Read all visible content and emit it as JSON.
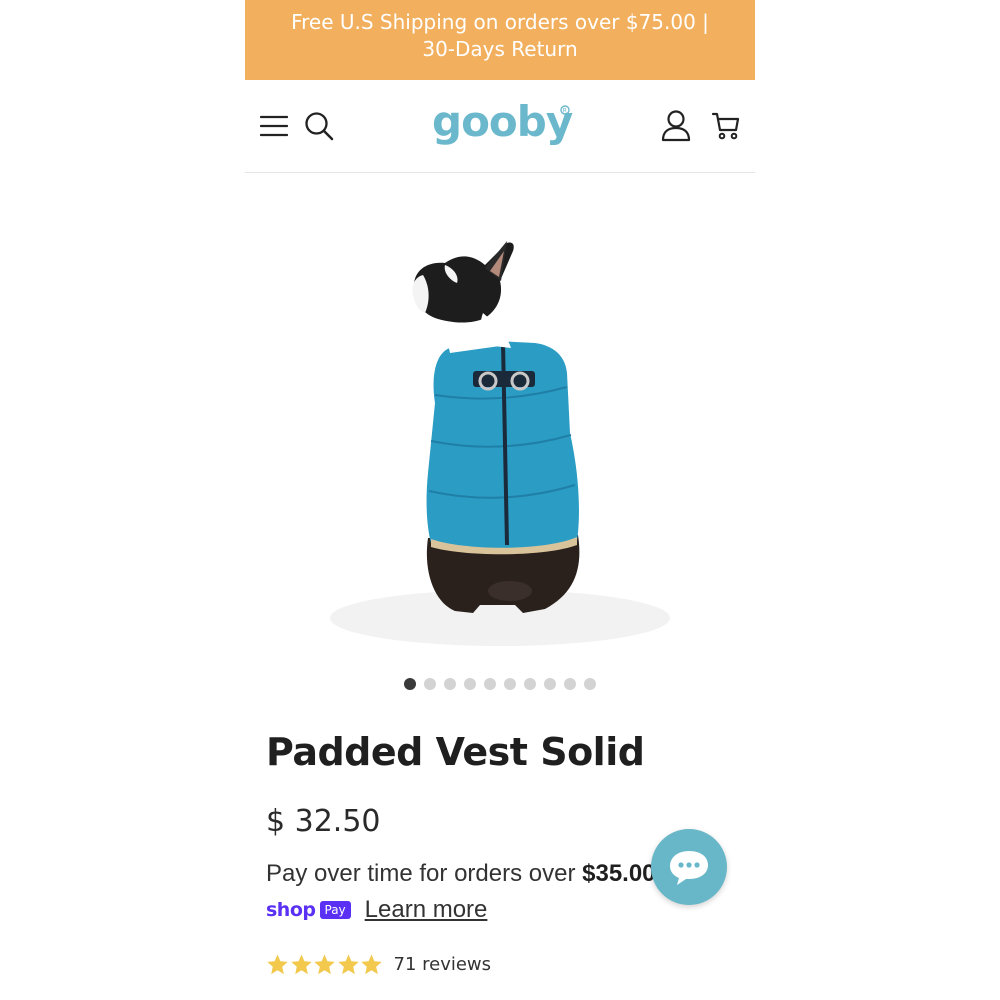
{
  "announcement": {
    "text": "Free U.S Shipping on orders over $75.00 | 30-Days Return"
  },
  "header": {
    "logo_text": "gooby",
    "icons": [
      "menu-icon",
      "search-icon",
      "account-icon",
      "cart-icon"
    ]
  },
  "gallery": {
    "slide_count": 10,
    "active_index": 0
  },
  "product": {
    "title": "Padded Vest Solid",
    "price": "$ 32.50",
    "installment_prefix": "Pay over time for orders over",
    "installment_amount": "$35.00",
    "shoppay_shop": "shop",
    "shoppay_pay": "Pay",
    "learn_more": "Learn more",
    "rating": 5,
    "reviews": "71 reviews"
  },
  "colors": {
    "announcement_bg": "#f2b05e",
    "brand_teal": "#6bb8cc",
    "star_gold": "#f2c94c",
    "shoppay_purple": "#5a31f4",
    "vest_blue": "#2b9cc4"
  }
}
